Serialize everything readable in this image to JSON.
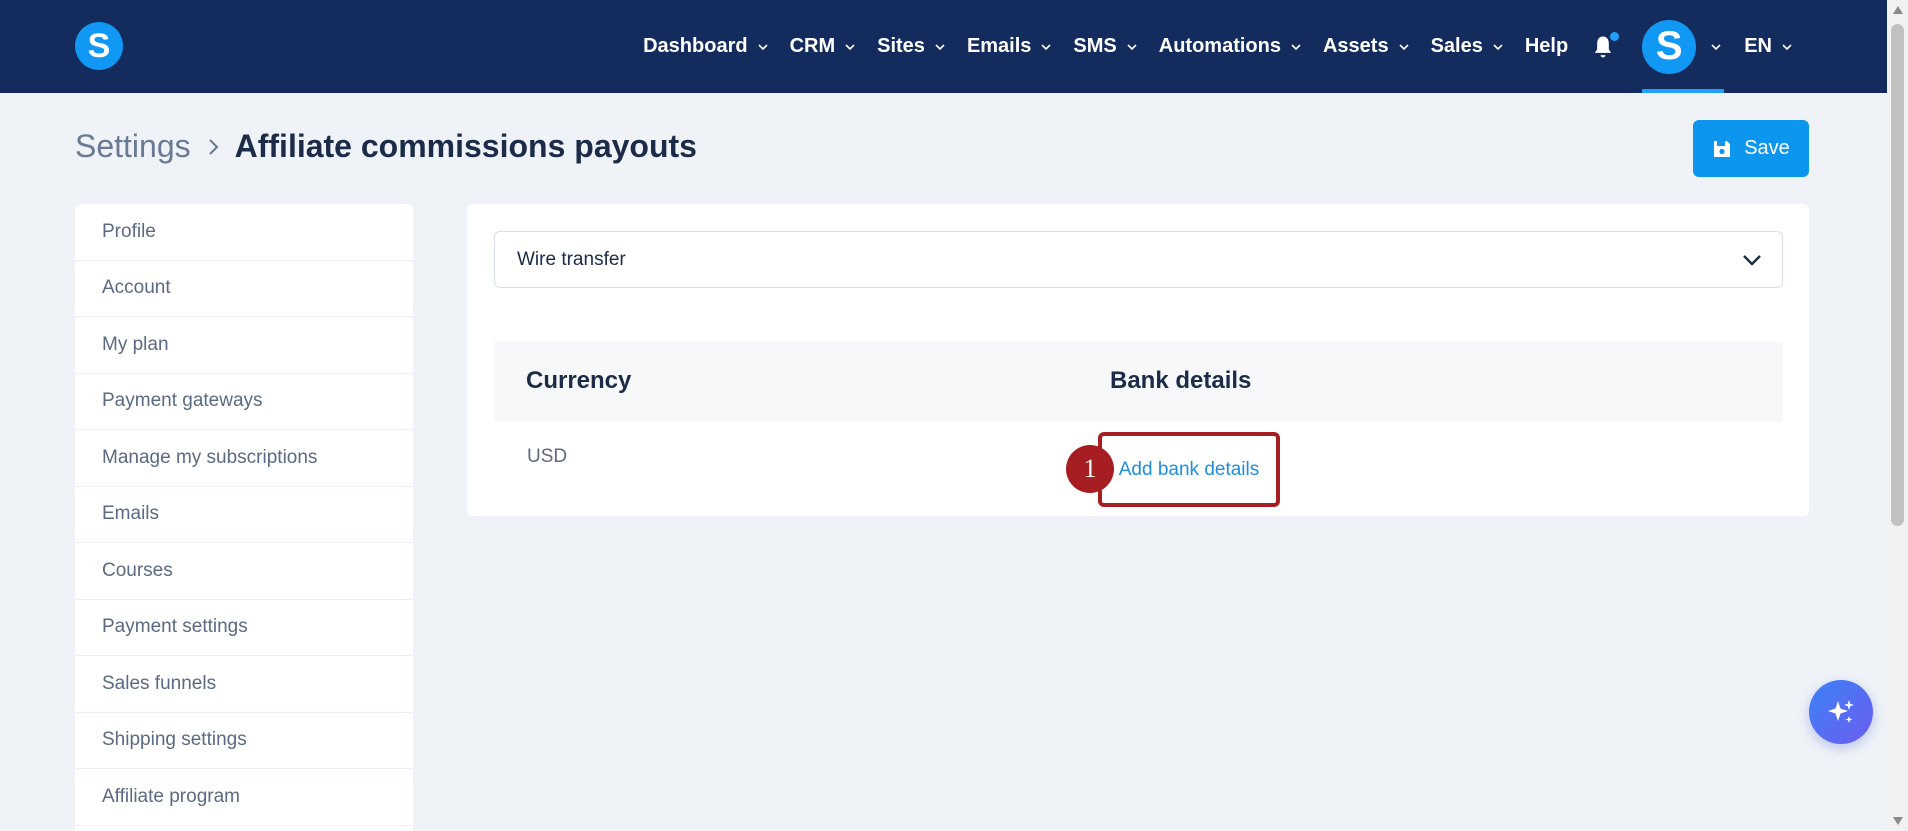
{
  "app": {
    "logo_letter": "S",
    "brand_color": "#1198f5",
    "topbar_color": "#142c5d"
  },
  "nav": {
    "items": [
      {
        "label": "Dashboard",
        "has_dropdown": true
      },
      {
        "label": "CRM",
        "has_dropdown": true
      },
      {
        "label": "Sites",
        "has_dropdown": true
      },
      {
        "label": "Emails",
        "has_dropdown": true
      },
      {
        "label": "SMS",
        "has_dropdown": true
      },
      {
        "label": "Automations",
        "has_dropdown": true
      },
      {
        "label": "Assets",
        "has_dropdown": true
      },
      {
        "label": "Sales",
        "has_dropdown": true
      },
      {
        "label": "Help",
        "has_dropdown": false
      }
    ],
    "notification_icon": "bell-icon",
    "avatar_letter": "S",
    "language": "EN"
  },
  "header": {
    "breadcrumb_root": "Settings",
    "title": "Affiliate commissions payouts",
    "save_label": "Save"
  },
  "sidebar": {
    "items": [
      {
        "label": "Profile"
      },
      {
        "label": "Account"
      },
      {
        "label": "My plan"
      },
      {
        "label": "Payment gateways"
      },
      {
        "label": "Manage my subscriptions"
      },
      {
        "label": "Emails"
      },
      {
        "label": "Courses"
      },
      {
        "label": "Payment settings"
      },
      {
        "label": "Sales funnels"
      },
      {
        "label": "Shipping settings"
      },
      {
        "label": "Affiliate program"
      }
    ]
  },
  "main": {
    "payout_method": "Wire transfer",
    "table": {
      "columns": [
        "Currency",
        "Bank details"
      ],
      "rows": [
        {
          "currency": "USD",
          "bank_details_link": "Add bank details"
        }
      ]
    },
    "annotation": {
      "step": "1",
      "color": "#a61e22"
    }
  }
}
